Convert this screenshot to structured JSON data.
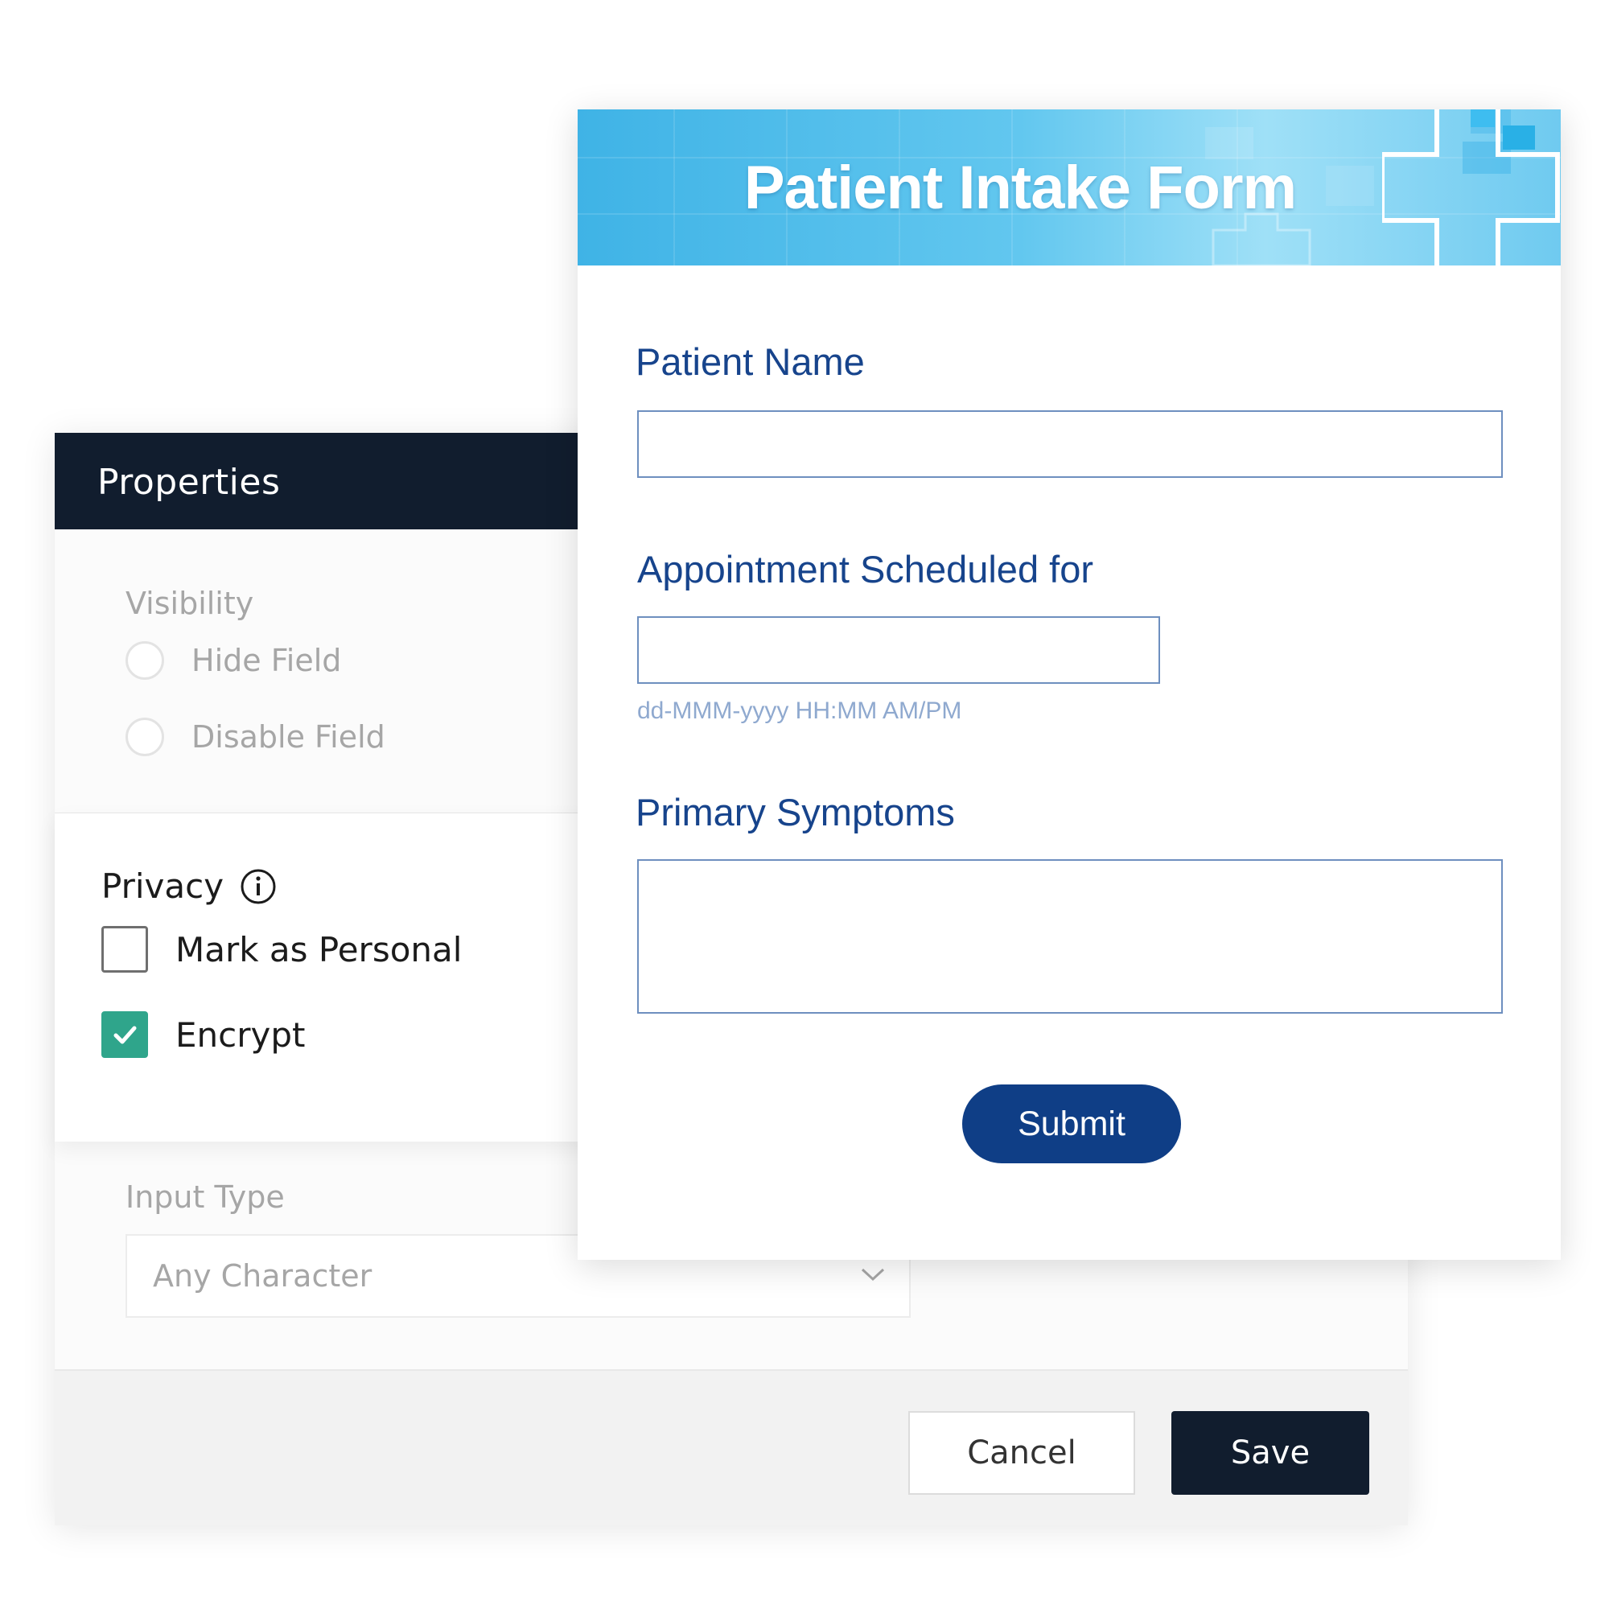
{
  "properties_panel": {
    "title": "Properties",
    "visibility": {
      "label": "Visibility",
      "options": [
        "Hide Field",
        "Disable Field"
      ]
    },
    "privacy": {
      "label": "Privacy",
      "info_icon": "info-icon",
      "options": [
        {
          "label": "Mark as Personal",
          "checked": false
        },
        {
          "label": "Encrypt",
          "checked": true
        }
      ]
    },
    "input_type": {
      "label": "Input Type",
      "selected": "Any Character",
      "chevron_icon": "chevron-down-icon"
    },
    "footer": {
      "cancel_label": "Cancel",
      "save_label": "Save"
    },
    "colors": {
      "header_bg": "#111d2e",
      "check_accent": "#2fa58b"
    }
  },
  "form": {
    "title": "Patient Intake Form",
    "banner_icon": "medical-cross-icon",
    "fields": {
      "patient_name": {
        "label": "Patient Name",
        "value": ""
      },
      "appointment": {
        "label": "Appointment Scheduled for",
        "value": "",
        "hint": "dd-MMM-yyyy HH:MM AM/PM"
      },
      "symptoms": {
        "label": "Primary Symptoms",
        "value": ""
      }
    },
    "submit_label": "Submit",
    "colors": {
      "label": "#17448c",
      "submit_bg": "#0f3e86",
      "banner": "#4ab8ea"
    }
  }
}
